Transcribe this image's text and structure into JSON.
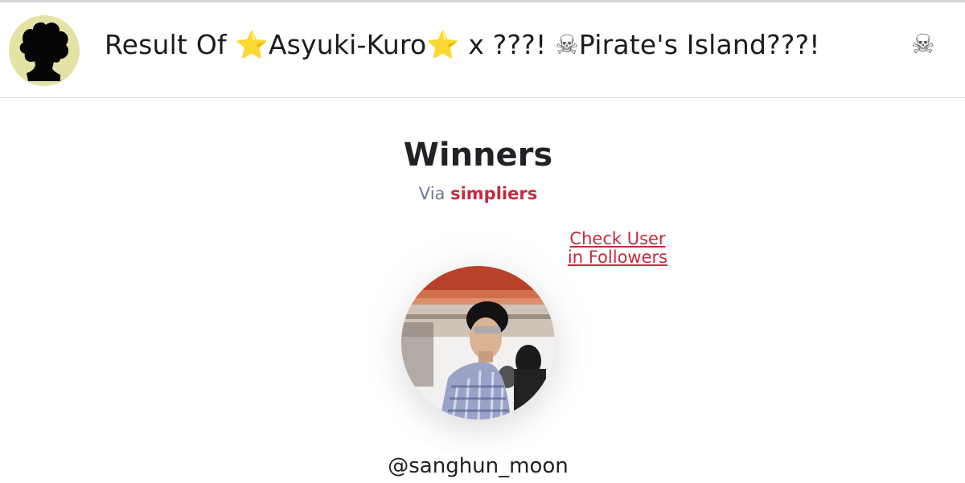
{
  "header": {
    "title_part1": "Result Of ",
    "star_glyph": "⭐",
    "title_part2": "Asyuki-Kuro",
    "title_part3": " x ???!  ",
    "skull_glyph": "☠",
    "title_part4": "Pirate's Island???!",
    "trailing_skull": "☠"
  },
  "main": {
    "title": "Winners",
    "via_label": "Via",
    "via_source": "simpliers",
    "check_link": "Check User in Followers"
  },
  "winner": {
    "handle": "@sanghun_moon"
  },
  "colors": {
    "accent": "#c8283f",
    "via_label": "#6e7890",
    "avatar_bg": "#e4e3a6"
  }
}
